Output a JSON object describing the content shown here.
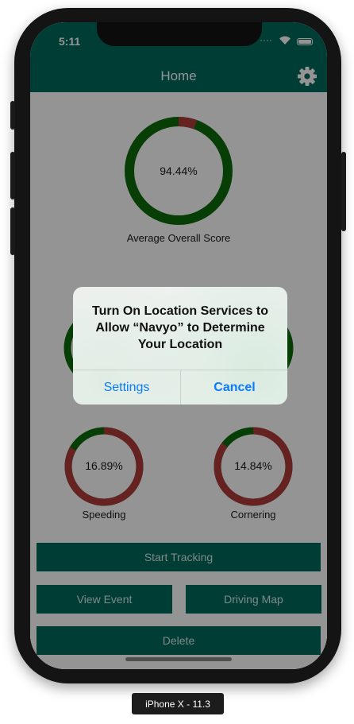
{
  "status_bar": {
    "time": "5:11"
  },
  "nav": {
    "title": "Home",
    "settings_icon": "gear-icon"
  },
  "colors": {
    "brand": "#00695c",
    "gauge_good": "#0b6b0b",
    "gauge_bad": "#b03a3a",
    "alert_button": "#0a7aff"
  },
  "gauges": {
    "average": {
      "value_text": "94.44%",
      "percent": 94.44,
      "label": "Average Overall Score"
    },
    "speeding": {
      "value_text": "16.89%",
      "percent": 16.89,
      "label": "Speeding"
    },
    "cornering": {
      "value_text": "14.84%",
      "percent": 14.84,
      "label": "Cornering"
    }
  },
  "buttons": {
    "start_tracking": "Start Tracking",
    "view_event": "View Event",
    "driving_map": "Driving Map",
    "delete": "Delete"
  },
  "alert": {
    "title": "Turn On Location Services to Allow “Navyo” to Determine Your Location",
    "settings": "Settings",
    "cancel": "Cancel"
  },
  "device_label": "iPhone X - 11.3"
}
